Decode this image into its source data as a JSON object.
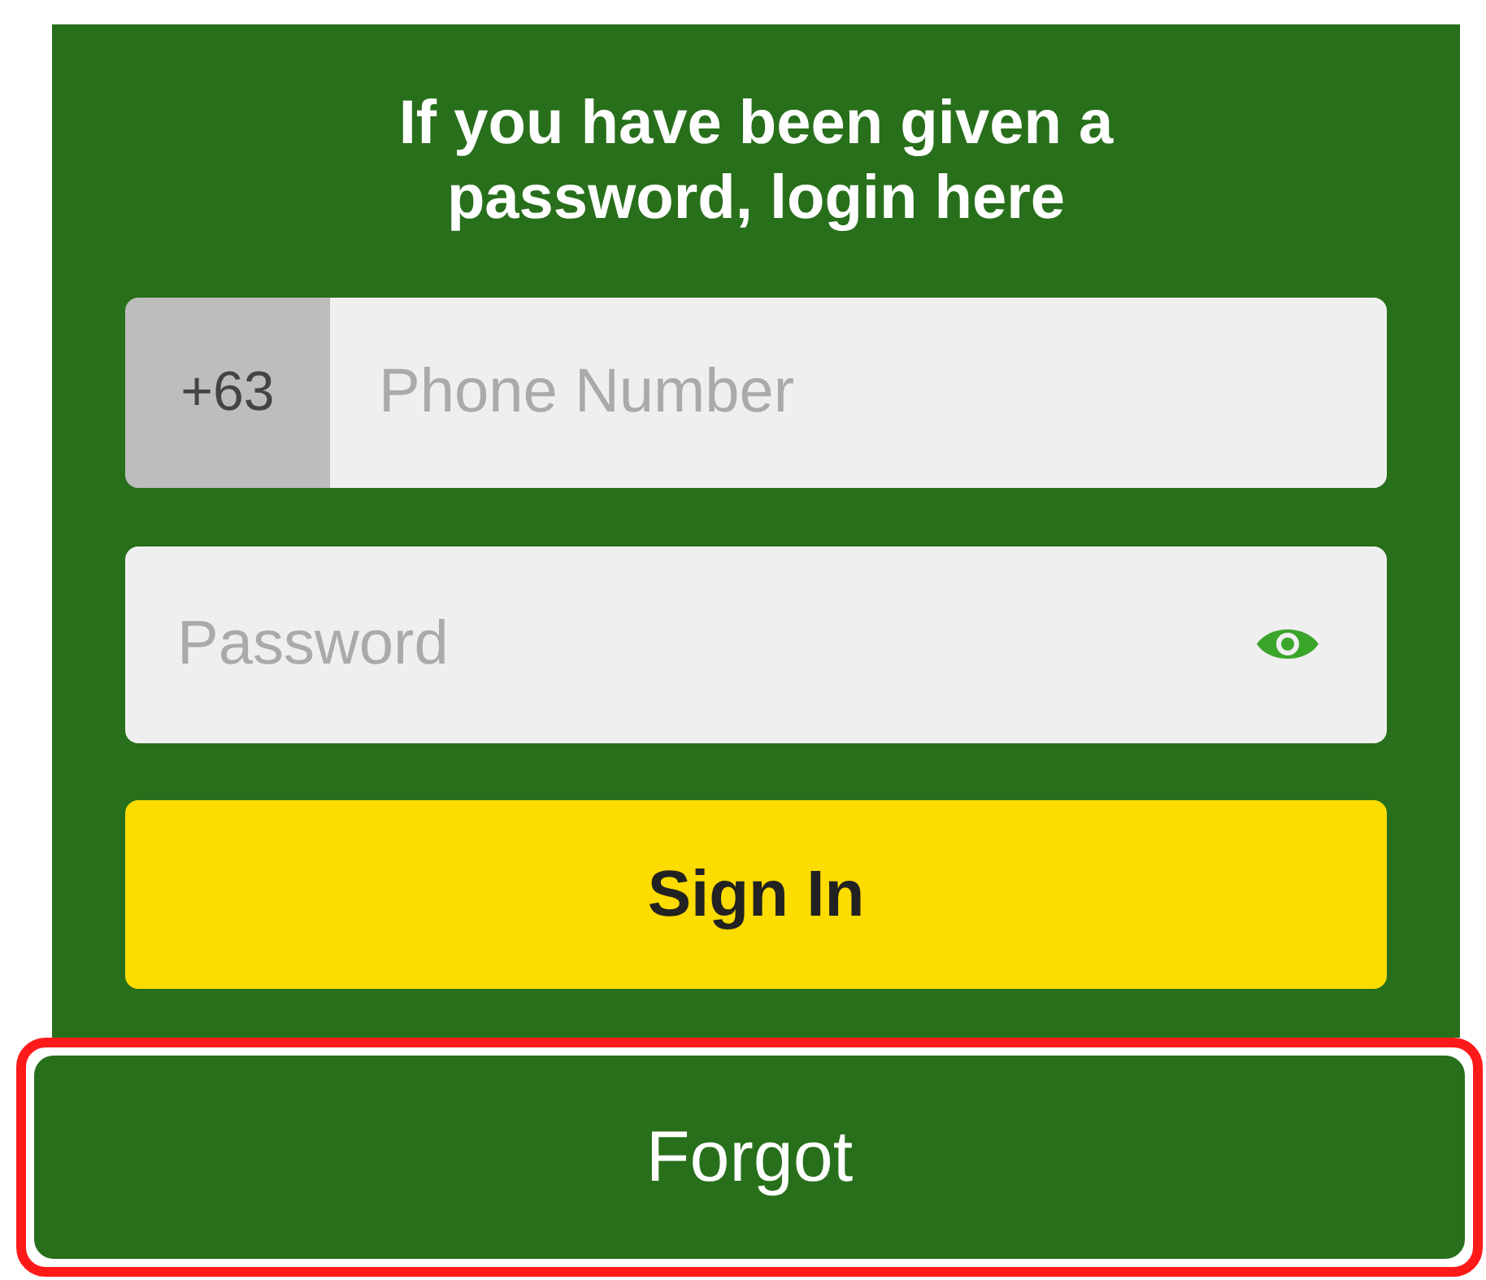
{
  "heading": "If you have been given a password, login here",
  "phone_field": {
    "prefix": "+63",
    "placeholder": "Phone Number"
  },
  "password_field": {
    "placeholder": "Password"
  },
  "sign_in_button": {
    "label": "Sign In"
  },
  "forgot_button": {
    "label": "Forgot",
    "highlighted": true
  }
}
